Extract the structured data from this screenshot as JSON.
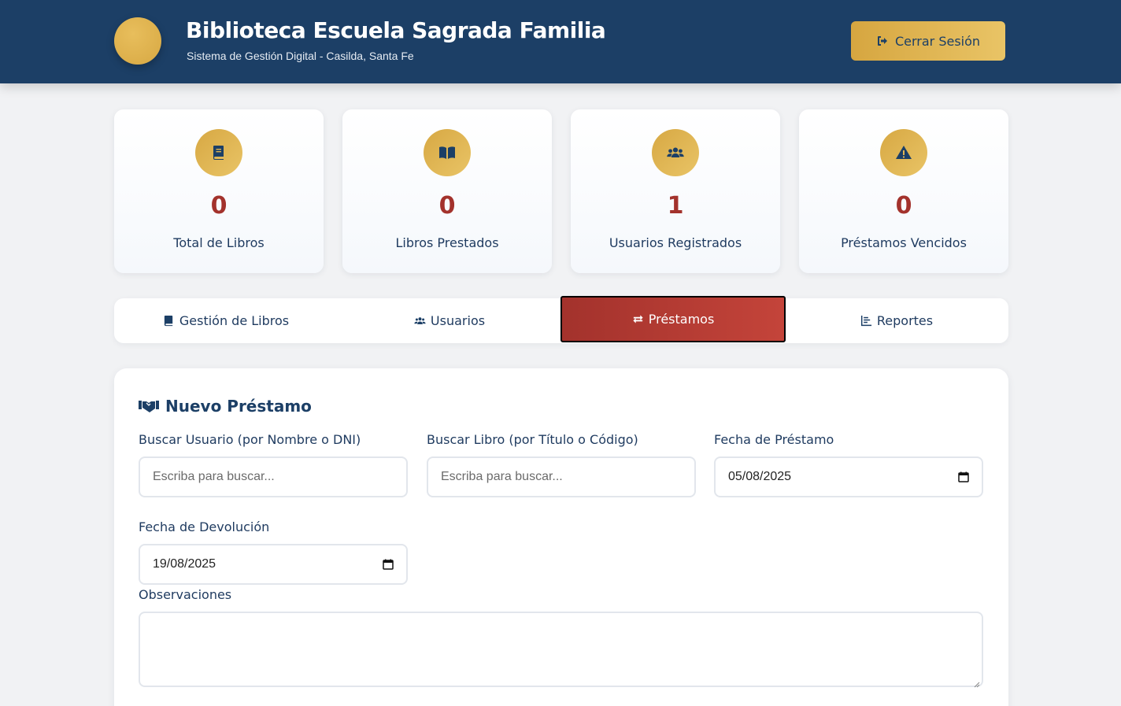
{
  "header": {
    "title": "Biblioteca Escuela Sagrada Familia",
    "subtitle": "Sistema de Gestión Digital - Casilda, Santa Fe",
    "logout_label": "Cerrar Sesión"
  },
  "stats": [
    {
      "value": "0",
      "label": "Total de Libros",
      "icon": "book-icon"
    },
    {
      "value": "0",
      "label": "Libros Prestados",
      "icon": "open-book-icon"
    },
    {
      "value": "1",
      "label": "Usuarios Registrados",
      "icon": "users-icon"
    },
    {
      "value": "0",
      "label": "Préstamos Vencidos",
      "icon": "warning-icon"
    }
  ],
  "tabs": [
    {
      "label": "Gestión de Libros",
      "icon": "book-icon"
    },
    {
      "label": "Usuarios",
      "icon": "users-icon"
    },
    {
      "label": "Préstamos",
      "icon": "exchange-icon",
      "active": true
    },
    {
      "label": "Reportes",
      "icon": "chart-icon"
    }
  ],
  "form": {
    "title": "Nuevo Préstamo",
    "user_search": {
      "label": "Buscar Usuario (por Nombre o DNI)",
      "placeholder": "Escriba para buscar..."
    },
    "book_search": {
      "label": "Buscar Libro (por Título o Código)",
      "placeholder": "Escriba para buscar..."
    },
    "loan_date": {
      "label": "Fecha de Préstamo",
      "value": "05/08/2025"
    },
    "return_date": {
      "label": "Fecha de Devolución",
      "value": "19/08/2025"
    },
    "notes": {
      "label": "Observaciones",
      "value": ""
    }
  },
  "colors": {
    "header_bg": "#1c3f66",
    "accent_gold": "#d7a843",
    "accent_red": "#a3322c",
    "text_navy": "#1e3a5f"
  }
}
